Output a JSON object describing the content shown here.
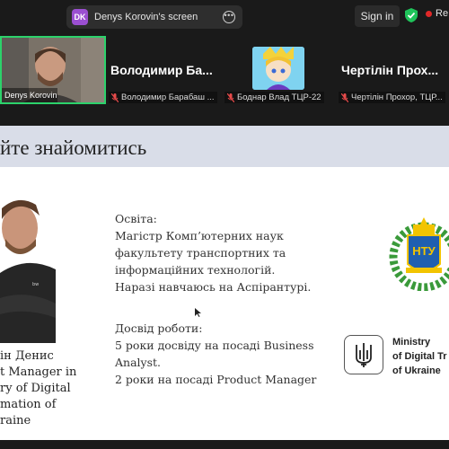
{
  "topbar": {
    "share_badge": "DK",
    "share_title": "Denys Korovin's screen",
    "sign_in_label": "Sign in",
    "recording_label": "Re"
  },
  "participants": {
    "main_name": "Denys Korovin",
    "tile2_big": "Володимир Ба...",
    "tile2_small": "Володимир Барабаш ...",
    "tile3_small": "Боднар Влад ТЦР-22",
    "tile4_big": "Чертілін Прох...",
    "tile4_small": "Чертілін Прохор, ТЦР..."
  },
  "slide": {
    "title": "йте знайомитись",
    "education_lines": [
      "Освіта:",
      "Магістр Комп’ютерних наук",
      "факультету транспортних та",
      "інформаційних технологій.",
      "Наразі навчаюсь на Аспірантурі."
    ],
    "experience_lines": [
      "Досвід роботи:",
      "5 роки досвіду на посаді Business",
      "Analyst.",
      "2 роки на посаді Product Manager"
    ],
    "left_lines": [
      "ін Денис",
      "t Manager in",
      "ry of Digital",
      "mation of",
      "raine"
    ],
    "ministry_lines": [
      "Ministry",
      "of Digital Tr",
      "of Ukraine"
    ],
    "ntu_logo_text": "НТУ"
  },
  "colors": {
    "active_speaker_border": "#2cd26b",
    "shield": "#1fc45a",
    "record": "#e02828",
    "slide_header": "#d9dde8"
  }
}
